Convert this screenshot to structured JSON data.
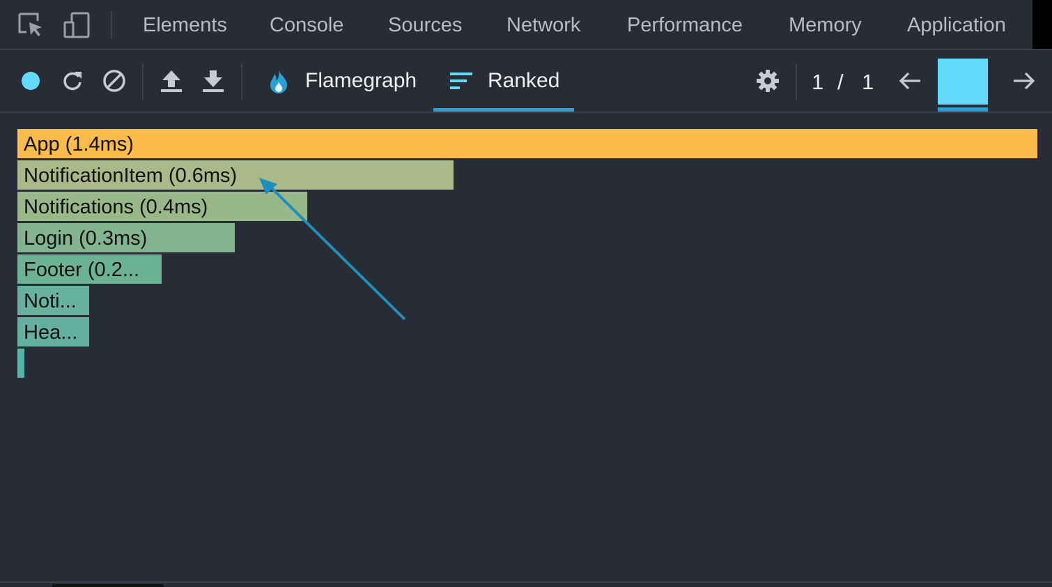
{
  "devtools": {
    "tabs": [
      {
        "label": "Elements"
      },
      {
        "label": "Console"
      },
      {
        "label": "Sources"
      },
      {
        "label": "Network"
      },
      {
        "label": "Performance"
      },
      {
        "label": "Memory"
      },
      {
        "label": "Application"
      }
    ],
    "icons": {
      "inspect": "inspect-element-icon",
      "device": "device-toolbar-icon"
    }
  },
  "profiler": {
    "toolbar": {
      "record": "record-icon",
      "reload": "reload-icon",
      "clear": "clear-icon",
      "upload": "load-profile-icon",
      "download": "save-profile-icon",
      "settings": "gear-icon",
      "prev": "arrow-left-icon",
      "next": "arrow-right-icon"
    },
    "modes": {
      "flamegraph": "Flamegraph",
      "ranked": "Ranked",
      "active": "Ranked"
    },
    "commit": {
      "current": "1",
      "separator": "/",
      "total": "1"
    },
    "colors": {
      "record": "#61dafb",
      "accent": "#2aa0d6",
      "commit_bar": "#61dafb"
    }
  },
  "ranked_bars": [
    {
      "label": "App (1.4ms)",
      "duration_ms": 1.4,
      "color": "#fbbc4b"
    },
    {
      "label": "NotificationItem (0.6ms)",
      "duration_ms": 0.6,
      "color": "#abb887"
    },
    {
      "label": "Notifications (0.4ms)",
      "duration_ms": 0.4,
      "color": "#99b889"
    },
    {
      "label": "Login (0.3ms)",
      "duration_ms": 0.3,
      "color": "#82b48f"
    },
    {
      "label": "Footer (0.2...",
      "duration_ms": 0.2,
      "color": "#6cb396"
    },
    {
      "label": "Noti...",
      "duration_ms": 0.1,
      "color": "#66b29c"
    },
    {
      "label": "Hea...",
      "duration_ms": 0.1,
      "color": "#63b0a0"
    },
    {
      "label": "",
      "duration_ms": 0.01,
      "color": "#4fb5ad"
    }
  ],
  "annotation": {
    "color": "#1e8fbb"
  }
}
